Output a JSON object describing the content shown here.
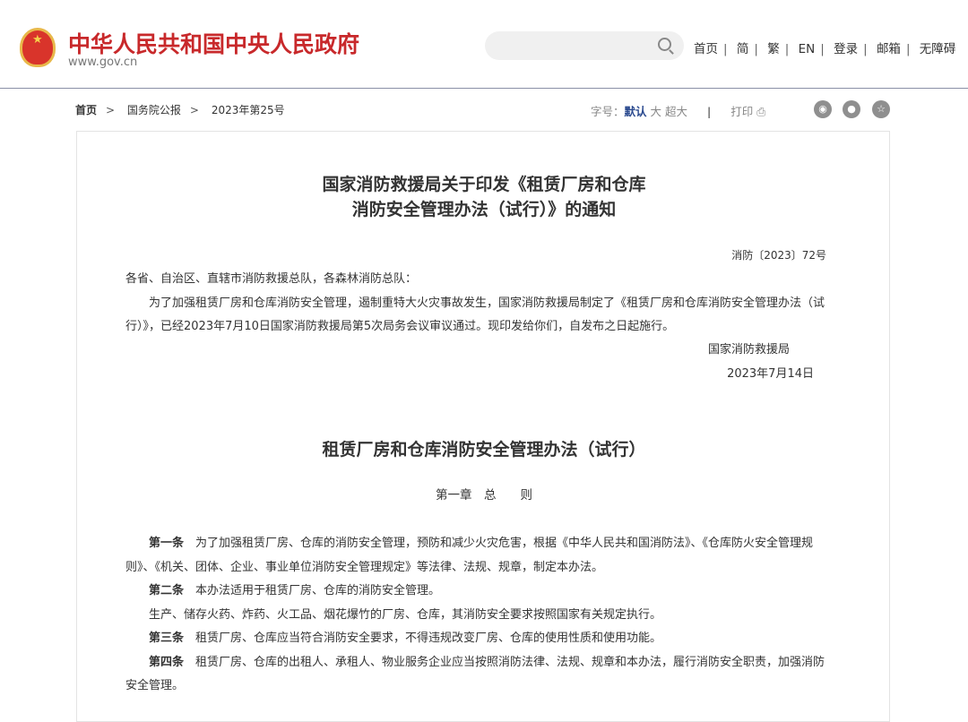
{
  "header": {
    "site_title": "中华人民共和国中央人民政府",
    "site_url": "www.gov.cn",
    "search_placeholder": "",
    "nav": [
      "首页",
      "简",
      "繁",
      "EN",
      "登录",
      "邮箱",
      "无障碍"
    ]
  },
  "breadcrumb": [
    "首页",
    "国务院公报",
    "2023年第25号"
  ],
  "tools": {
    "font_label": "字号：",
    "font_default": "默认",
    "font_large": "大",
    "font_xlarge": "超大",
    "print": "打印"
  },
  "notice": {
    "title_line1": "国家消防救援局关于印发《租赁厂房和仓库",
    "title_line2": "消防安全管理办法（试行）》的通知",
    "doc_number": "消防〔2023〕72号",
    "salutation": "各省、自治区、直辖市消防救援总队，各森林消防总队：",
    "body": "为了加强租赁厂房和仓库消防安全管理，遏制重特大火灾事故发生，国家消防救援局制定了《租赁厂房和仓库消防安全管理办法（试行）》，已经2023年7月10日国家消防救援局第5次局务会议审议通过。现印发给你们，自发布之日起施行。",
    "signature": "国家消防救援局",
    "date": "2023年7月14日"
  },
  "measures": {
    "title": "租赁厂房和仓库消防安全管理办法（试行）",
    "chapter": "第一章　总　　则",
    "articles": [
      {
        "label": "第一条",
        "text": "为了加强租赁厂房、仓库的消防安全管理，预防和减少火灾危害，根据《中华人民共和国消防法》、《仓库防火安全管理规则》、《机关、团体、企业、事业单位消防安全管理规定》等法律、法规、规章，制定本办法。"
      },
      {
        "label": "第二条",
        "text": "本办法适用于租赁厂房、仓库的消防安全管理。"
      },
      {
        "label": "",
        "text": "生产、储存火药、炸药、火工品、烟花爆竹的厂房、仓库，其消防安全要求按照国家有关规定执行。"
      },
      {
        "label": "第三条",
        "text": "租赁厂房、仓库应当符合消防安全要求，不得违规改变厂房、仓库的使用性质和使用功能。"
      },
      {
        "label": "第四条",
        "text": "租赁厂房、仓库的出租人、承租人、物业服务企业应当按照消防法律、法规、规章和本办法，履行消防安全职责，加强消防安全管理。"
      }
    ]
  }
}
